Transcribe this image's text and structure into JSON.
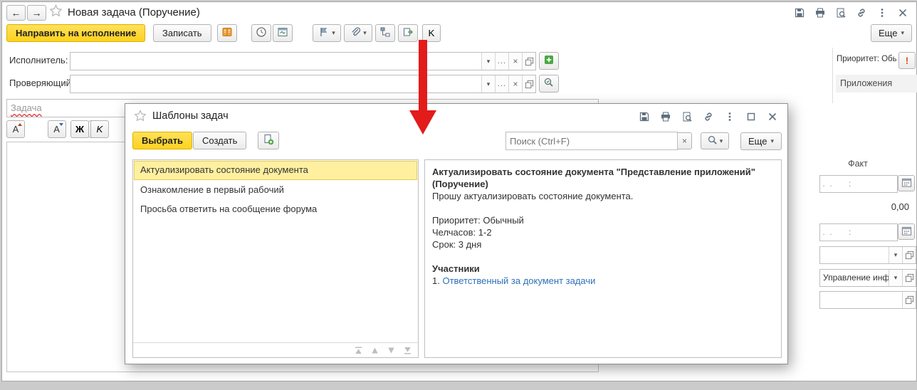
{
  "window": {
    "title": "Новая задача (Поручение)"
  },
  "toolbar": {
    "send_label": "Направить на исполнение",
    "record_label": "Записать",
    "k_label": "K",
    "more_label": "Еще"
  },
  "form": {
    "executor_label": "Исполнитель:",
    "reviewer_label": "Проверяющий:",
    "task_placeholder": "Задача",
    "format": {
      "a1": "А",
      "a2": "А",
      "a3": "А",
      "bold": "Ж",
      "italic": "K"
    }
  },
  "right_panel": {
    "priority_value": "Приоритет: Обычный",
    "attachments_label": "Приложения",
    "fact_label": "Факт",
    "date_placeholder": " .  .       :",
    "amount_value": "0,00",
    "department_value": "Управление инфс"
  },
  "modal": {
    "title": "Шаблоны задач",
    "select_label": "Выбрать",
    "create_label": "Создать",
    "search_placeholder": "Поиск (Ctrl+F)",
    "more_label": "Еще",
    "list": [
      "Актуализировать состояние документа",
      "Ознакомление в первый рабочий",
      "Просьба ответить на сообщение форума"
    ],
    "detail": {
      "title": "Актуализировать состояние документа \"Представление приложений\" (Поручение)",
      "request": "Прошу актуализировать состояние документа.",
      "priority": "Приоритет: Обычный",
      "manhours": "Челчасов: 1-2",
      "term": "Срок: 3 дня",
      "participants_header": "Участники",
      "participant_number": "1.",
      "participant_link": "Ответственный за документ задачи"
    }
  }
}
